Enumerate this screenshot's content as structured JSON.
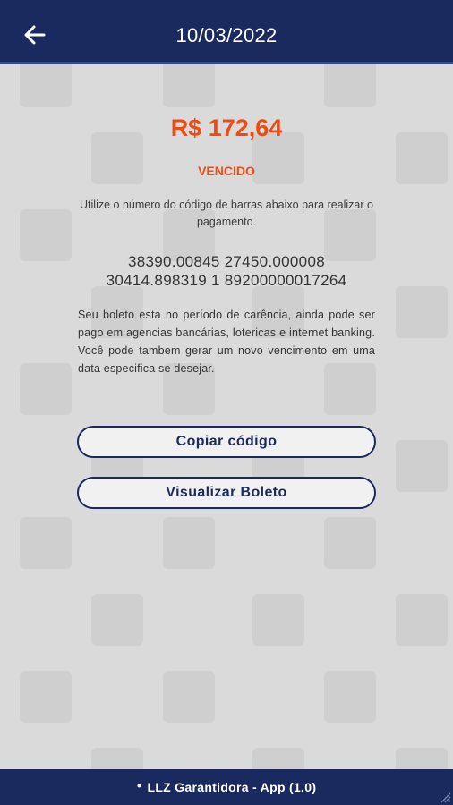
{
  "header": {
    "title": "10/03/2022",
    "back_icon": "arrow-left-icon"
  },
  "payment": {
    "amount": "R$ 172,64",
    "status": "VENCIDO",
    "instructions": "Utilize o número do código de barras abaixo para realizar o pagamento.",
    "barcode_line1": "38390.00845 27450.000008",
    "barcode_line2": "30414.898319 1 89200000017264",
    "note": "Seu boleto esta no período de carência, ainda pode ser pago em agencias bancárias, lotericas e internet banking. Você pode tambem gerar um novo vencimento em uma data especifica se desejar."
  },
  "buttons": {
    "copy_label": "Copiar código",
    "view_label": "Visualizar Boleto"
  },
  "footer": {
    "label": "LLZ Garantidora - App (1.0)",
    "dot": "●"
  },
  "colors": {
    "primary": "#1b2a5e",
    "accent": "#f14a10",
    "background": "#dadada"
  }
}
